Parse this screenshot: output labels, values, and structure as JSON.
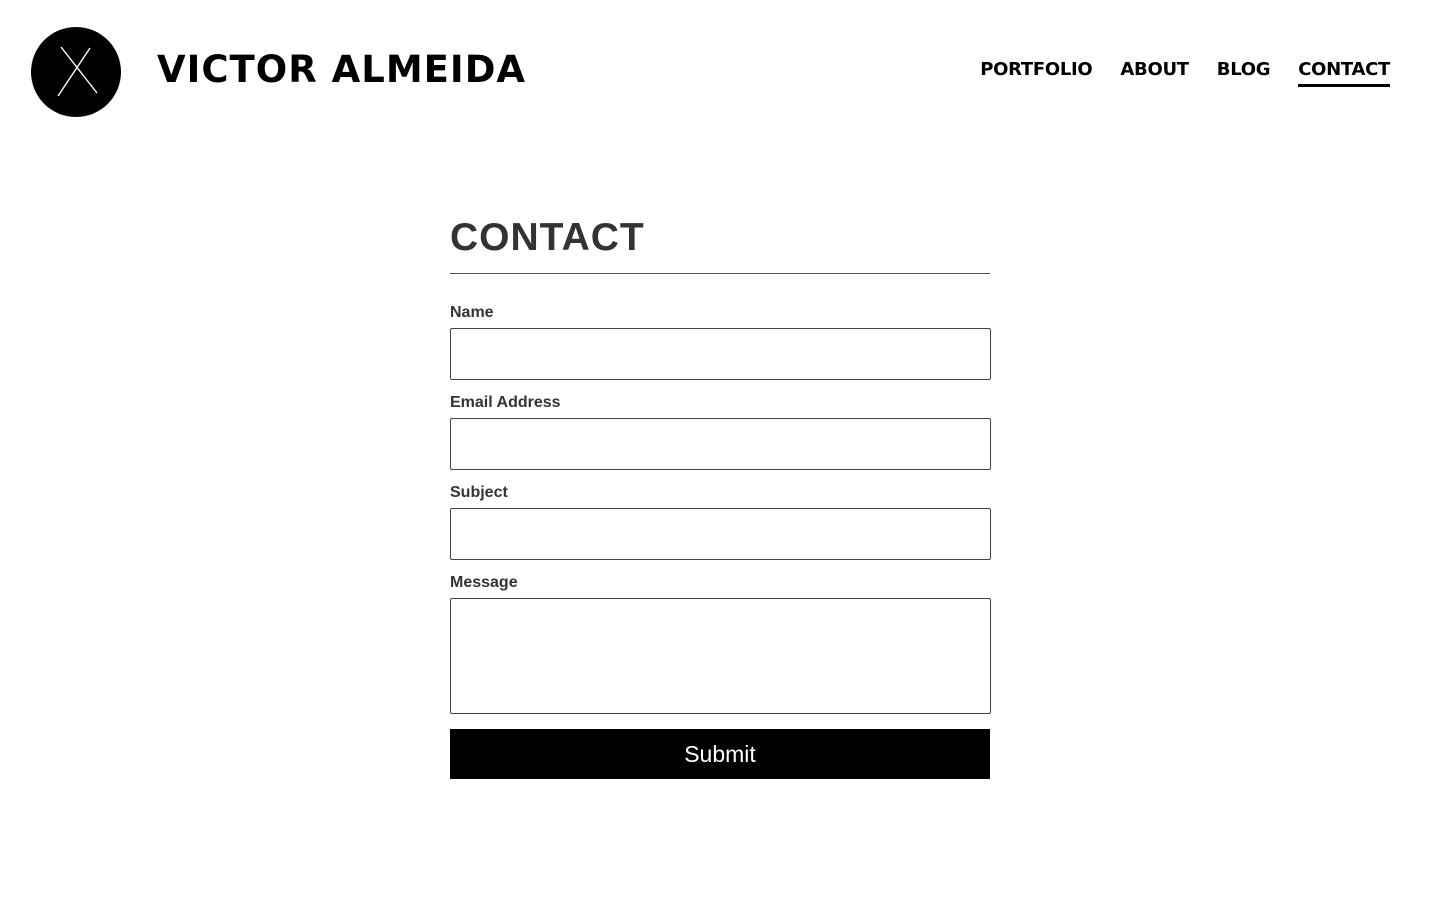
{
  "header": {
    "site_title": "VICTOR ALMEIDA",
    "nav": [
      {
        "label": "PORTFOLIO",
        "active": false
      },
      {
        "label": "ABOUT",
        "active": false
      },
      {
        "label": "BLOG",
        "active": false
      },
      {
        "label": "CONTACT",
        "active": true
      }
    ]
  },
  "main": {
    "title": "CONTACT",
    "form": {
      "name_label": "Name",
      "name_value": "",
      "email_label": "Email Address",
      "email_value": "",
      "subject_label": "Subject",
      "subject_value": "",
      "message_label": "Message",
      "message_value": "",
      "submit_label": "Submit"
    }
  },
  "colors": {
    "text": "#000000",
    "heading": "#333333",
    "button_bg": "#000000",
    "button_text": "#ffffff",
    "background": "#ffffff"
  },
  "icons": {
    "logo": "x-monogram-logo"
  }
}
